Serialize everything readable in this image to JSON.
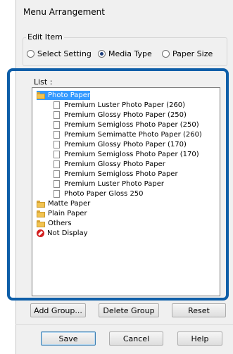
{
  "dialog": {
    "title": "Menu Arrangement"
  },
  "edit_item": {
    "label": "Edit Item",
    "options": [
      {
        "label": "Select Setting",
        "selected": false
      },
      {
        "label": "Media Type",
        "selected": true
      },
      {
        "label": "Paper Size",
        "selected": false
      }
    ]
  },
  "list": {
    "label": "List :",
    "items": [
      {
        "label": "Photo Paper",
        "kind": "folder",
        "selected": true
      },
      {
        "label": "Premium Luster Photo Paper (260)",
        "kind": "doc"
      },
      {
        "label": "Premium Glossy Photo Paper (250)",
        "kind": "doc"
      },
      {
        "label": "Premium Semigloss Photo Paper (250)",
        "kind": "doc"
      },
      {
        "label": "Premium Semimatte Photo Paper (260)",
        "kind": "doc"
      },
      {
        "label": "Premium Glossy Photo Paper (170)",
        "kind": "doc"
      },
      {
        "label": "Premium Semigloss Photo Paper (170)",
        "kind": "doc"
      },
      {
        "label": "Premium Glossy Photo Paper",
        "kind": "doc"
      },
      {
        "label": "Premium Semigloss Photo Paper",
        "kind": "doc"
      },
      {
        "label": "Premium Luster Photo Paper",
        "kind": "doc"
      },
      {
        "label": "Photo Paper Gloss 250",
        "kind": "doc"
      },
      {
        "label": "Matte Paper",
        "kind": "folder"
      },
      {
        "label": "Plain Paper",
        "kind": "folder"
      },
      {
        "label": "Others",
        "kind": "folder"
      },
      {
        "label": "Not Display",
        "kind": "noentry"
      }
    ]
  },
  "buttons": {
    "add_group": "Add Group...",
    "delete_group": "Delete Group",
    "reset": "Reset",
    "save": "Save",
    "cancel": "Cancel",
    "help": "Help"
  },
  "colors": {
    "highlight": "#0e5ea8",
    "selection": "#3399ff"
  }
}
